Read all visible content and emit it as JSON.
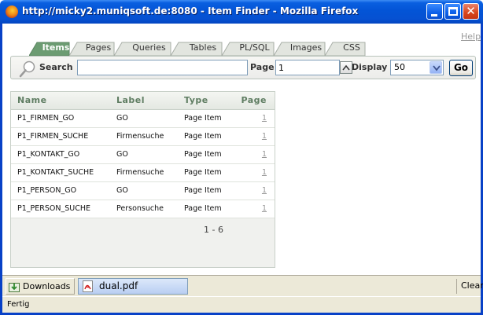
{
  "window": {
    "title": "http://micky2.muniqsoft.de:8080 - Item Finder - Mozilla Firefox"
  },
  "header": {
    "help_label": "Help"
  },
  "tabs": [
    {
      "label": "Items",
      "active": true
    },
    {
      "label": "Pages",
      "active": false
    },
    {
      "label": "Queries",
      "active": false
    },
    {
      "label": "Tables",
      "active": false
    },
    {
      "label": "PL/SQL",
      "active": false
    },
    {
      "label": "Images",
      "active": false
    },
    {
      "label": "CSS",
      "active": false
    }
  ],
  "search": {
    "label": "Search",
    "value": "",
    "page_label": "Page",
    "page_value": "1",
    "display_label": "Display",
    "display_value": "50",
    "go_label": "Go"
  },
  "table": {
    "columns": [
      "Name",
      "Label",
      "Type",
      "Page"
    ],
    "rows": [
      [
        "P1_FIRMEN_GO",
        "GO",
        "Page Item",
        "1"
      ],
      [
        "P1_FIRMEN_SUCHE",
        "Firmensuche",
        "Page Item",
        "1"
      ],
      [
        "P1_KONTAKT_GO",
        "GO",
        "Page Item",
        "1"
      ],
      [
        "P1_KONTAKT_SUCHE",
        "Firmensuche",
        "Page Item",
        "1"
      ],
      [
        "P1_PERSON_GO",
        "GO",
        "Page Item",
        "1"
      ],
      [
        "P1_PERSON_SUCHE",
        "Personsuche",
        "Page Item",
        "1"
      ]
    ],
    "pagination": "1 - 6"
  },
  "downloads": {
    "button_label": "Downloads",
    "item_label": "dual.pdf",
    "clear_label": "Clear"
  },
  "status": {
    "text": "Fertig"
  },
  "colors": {
    "titlebar": "#0354d6",
    "tab_active": "#6c9c72",
    "tab_inactive": "#dfe3dc",
    "header_text": "#5f7d62",
    "link_gray": "#999999"
  }
}
